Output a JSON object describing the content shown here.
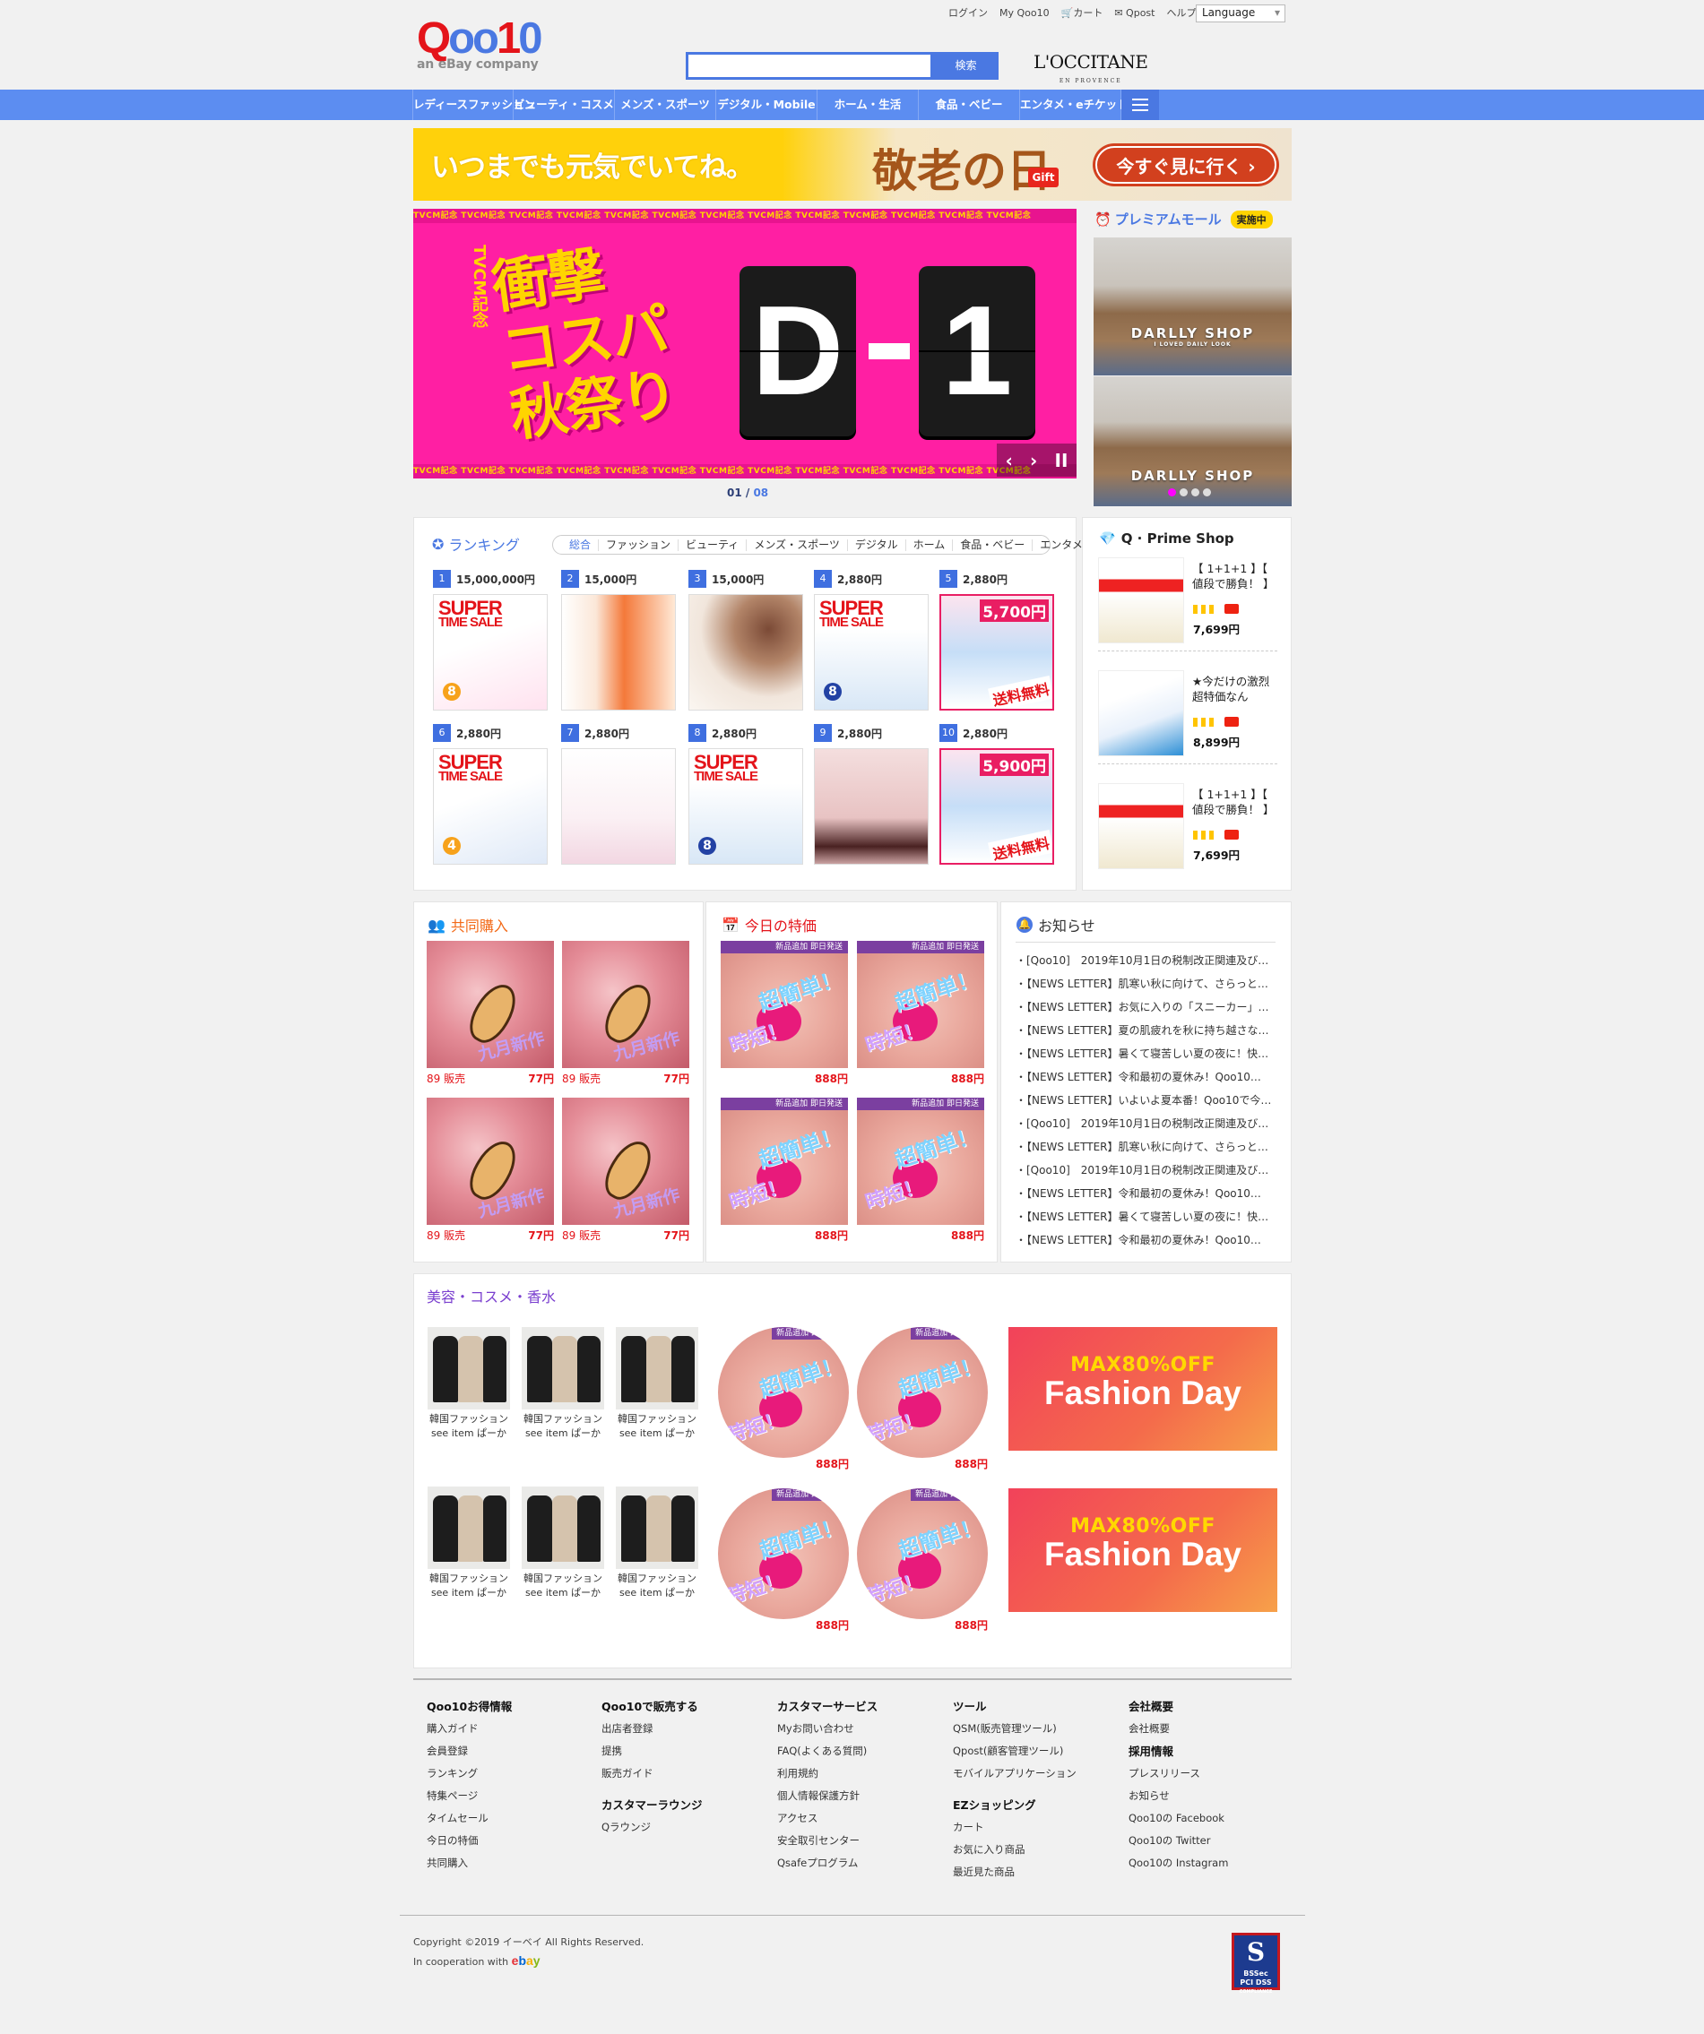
{
  "header": {
    "util_links": [
      "ログイン",
      "My Qoo10",
      "カート",
      "Qpost",
      "ヘルプ"
    ],
    "language": "Language",
    "logo": {
      "text": "Qoo10",
      "sub": "an eBay company"
    },
    "search": {
      "button": "検索",
      "placeholder": ""
    },
    "partner": {
      "name": "L'OCCITANE",
      "sub": "EN PROVENCE"
    }
  },
  "nav": {
    "items": [
      "レディースファッション",
      "ビューティ・コスメ",
      "メンズ・スポーツ",
      "デジタル・Mobile",
      "ホーム・生活",
      "食品・ベビー",
      "エンタメ・eチケット"
    ]
  },
  "promo_banner": {
    "text": "いつまでも元気でいてね。",
    "mark": "敬老の日",
    "gift": "Gift",
    "cta": "今すぐ見に行く"
  },
  "hero": {
    "stripe": "TVCM記念 TVCM記念 TVCM記念 TVCM記念 TVCM記念 TVCM記念 TVCM記念 TVCM記念 TVCM記念 TVCM記念 TVCM記念 TVCM記念 TVCM記念",
    "tvcm": "TVCM記念",
    "lines": [
      "衝撃",
      "コスパ",
      "秋祭り"
    ],
    "card_left": "D",
    "card_right": "1",
    "controls": [
      "‹",
      "›",
      "II"
    ],
    "pager_current": "01",
    "pager_total": "08"
  },
  "premium_mall": {
    "title": "プレミアムモール",
    "badge": "実施中",
    "shop": "DARLLY SHOP",
    "shop_sub": "I LOVED DAILY LOOK"
  },
  "ranking": {
    "title": "ランキング",
    "tabs": [
      "総合",
      "ファッション",
      "ビューティ",
      "メンズ・スポーツ",
      "デジタル",
      "ホーム",
      "食品・ベビー",
      "エンタメ"
    ],
    "items": [
      {
        "rank": "1",
        "price": "15,000,000円"
      },
      {
        "rank": "2",
        "price": "15,000円"
      },
      {
        "rank": "3",
        "price": "15,000円"
      },
      {
        "rank": "4",
        "price": "2,880円"
      },
      {
        "rank": "5",
        "price": "2,880円"
      },
      {
        "rank": "6",
        "price": "2,880円"
      },
      {
        "rank": "7",
        "price": "2,880円"
      },
      {
        "rank": "8",
        "price": "2,880円"
      },
      {
        "rank": "9",
        "price": "2,880円"
      },
      {
        "rank": "10",
        "price": "2,880円"
      }
    ],
    "super": "SUPER",
    "time_sale": "TIME SALE",
    "coupon_a": "5,700円",
    "coupon_b": "5,900円",
    "free_ship": "送料無料"
  },
  "qprime": {
    "title": "Q · Prime Shop",
    "items": [
      {
        "name": "【 1+1+1 】【 値段で勝負！ 】【",
        "price": "7,699円"
      },
      {
        "name": "★今だけの激烈超特価なん",
        "price": "8,899円"
      },
      {
        "name": "【 1+1+1 】【 値段で勝負！ 】【",
        "price": "7,699円"
      }
    ]
  },
  "group_buy": {
    "title": "共同購入",
    "tag": "九月新作",
    "items": [
      {
        "sold": "89 販売",
        "price": "77円"
      },
      {
        "sold": "89 販売",
        "price": "77円"
      },
      {
        "sold": "89 販売",
        "price": "77円"
      },
      {
        "sold": "89 販売",
        "price": "77円"
      }
    ]
  },
  "today_deal": {
    "title": "今日の特価",
    "ribbon": "新品追加 即日発送",
    "big": "超簡単！",
    "big2": "時短！",
    "items": [
      {
        "price": "888円"
      },
      {
        "price": "888円"
      },
      {
        "price": "888円"
      },
      {
        "price": "888円"
      }
    ]
  },
  "notices": {
    "title": "お知らせ",
    "items": [
      "・[Qoo10]　2019年10月1日の税制改正関連及び…",
      "・【NEWS LETTER】肌寒い秋に向けて、さらっと羽…",
      "・【NEWS LETTER】お気に入りの「スニーカー」を…",
      "・【NEWS LETTER】夏の肌疲れを秋に持ち越さな…",
      "・【NEWS LETTER】暑くて寝苦しい夏の夜に！快…",
      "・【NEWS LETTER】令和最初の夏休み！Qoo10…",
      "・【NEWS LETTER】いよいよ夏本番！Qoo10で今…",
      "・[Qoo10]　2019年10月1日の税制改正関連及び…",
      "・【NEWS LETTER】肌寒い秋に向けて、さらっと羽…",
      "・[Qoo10]　2019年10月1日の税制改正関連及び…",
      "・【NEWS LETTER】令和最初の夏休み！Qoo10…",
      "・【NEWS LETTER】暑くて寝苦しい夏の夜に！快…",
      "・【NEWS LETTER】令和最初の夏休み！Qoo10…"
    ]
  },
  "beauty": {
    "title": "美容・コスメ・香水",
    "items": [
      {
        "line1": "韓国ファッション",
        "line2": "see item ぱーか"
      },
      {
        "line1": "韓国ファッション",
        "line2": "see item ぱーか"
      },
      {
        "line1": "韓国ファッション",
        "line2": "see item ぱーか"
      },
      {
        "line1": "韓国ファッション",
        "line2": "see item ぱーか"
      },
      {
        "line1": "韓国ファッション",
        "line2": "see item ぱーか"
      },
      {
        "line1": "韓国ファッション",
        "line2": "see item ぱーか"
      }
    ],
    "circles": [
      {
        "price": "888円"
      },
      {
        "price": "888円"
      },
      {
        "price": "888円"
      },
      {
        "price": "888円"
      }
    ],
    "fashion_day": {
      "max": "MAX80%OFF",
      "title": "Fashion Day"
    }
  },
  "footer": {
    "columns": [
      {
        "head": "Qoo10お得情報",
        "links": [
          "購入ガイド",
          "会員登録",
          "ランキング",
          "特集ページ",
          "タイムセール",
          "今日の特価",
          "共同購入"
        ]
      },
      {
        "head": "Qoo10で販売する",
        "links": [
          "出店者登録",
          "提携",
          "販売ガイド"
        ],
        "head2": "カスタマーラウンジ",
        "links2": [
          "Qラウンジ"
        ]
      },
      {
        "head": "カスタマーサービス",
        "links": [
          "Myお問い合わせ",
          "FAQ(よくある質問)",
          "利用規約",
          "個人情報保護方針",
          "アクセス",
          "安全取引センター",
          "Qsafeプログラム"
        ]
      },
      {
        "head": "ツール",
        "links": [
          "QSM(販売管理ツール)",
          "Qpost(顧客管理ツール)",
          "モバイルアプリケーション"
        ],
        "head2": "EZショッピング",
        "links2": [
          "カート",
          "お気に入り商品",
          "最近見た商品"
        ]
      },
      {
        "head": "会社概要",
        "links": [
          "会社概要"
        ],
        "head2": "採用情報",
        "links2": [
          "プレスリリース",
          "お知らせ",
          "Qoo10の Facebook",
          "Qoo10の Twitter",
          "Qoo10の Instagram"
        ]
      }
    ],
    "copyright": "Copyright ©2019 イーベイ All Rights Reserved.",
    "coop": "In cooperation with",
    "ebay": "ebay",
    "pci": {
      "mark": "S",
      "l1": "BSSec",
      "l2": "PCI DSS",
      "l3": "COMPLIANCE"
    }
  },
  "colors": {
    "brand_blue": "#4a78e2",
    "nav_blue": "#5c8df1",
    "sale_red": "#e4141a",
    "hero_pink": "#ff1fa3",
    "accent_yellow": "#ffd400"
  }
}
